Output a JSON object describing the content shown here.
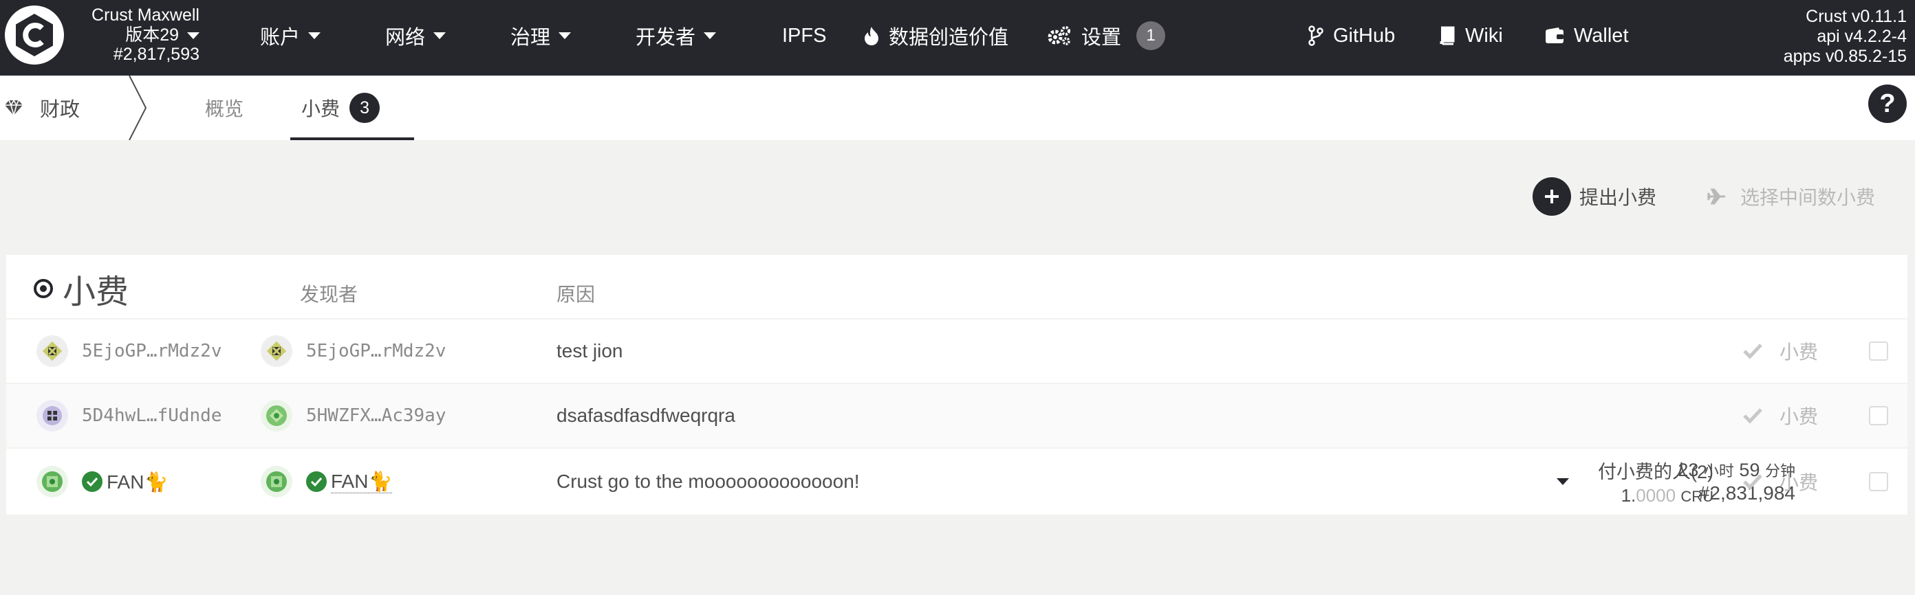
{
  "topbar": {
    "chain_name": "Crust Maxwell",
    "version_label": "版本29",
    "block_number": "#2,817,593",
    "nav": {
      "accounts": "账户",
      "network": "网络",
      "governance": "治理",
      "developer": "开发者",
      "ipfs": "IPFS",
      "data_value": "数据创造价值",
      "settings": "设置",
      "settings_badge": "1",
      "github": "GitHub",
      "wiki": "Wiki",
      "wallet": "Wallet"
    },
    "versions": {
      "crust": "Crust v0.11.1",
      "api": "api v4.2.2-4",
      "apps": "apps v0.85.2-15"
    }
  },
  "subnav": {
    "section": "财政",
    "tabs": [
      {
        "label": "概览"
      },
      {
        "label": "小费",
        "badge": "3"
      }
    ],
    "help": "?"
  },
  "actions": {
    "propose_tip": "提出小费",
    "select_median": "选择中间数小费"
  },
  "table": {
    "title": "小费",
    "col_finder": "发现者",
    "col_reason": "原因",
    "rows": [
      {
        "who": "5EjoGP…rMdz2v",
        "finder": "5EjoGP…rMdz2v",
        "reason": "test jion",
        "action": "小费"
      },
      {
        "who": "5D4hwL…fUdnde",
        "finder": "5HWZFX…Ac39ay",
        "reason": "dsafasdfasdfweqrqra",
        "action": "小费"
      },
      {
        "who": "FAN🐈",
        "finder": "FAN🐈",
        "reason": "Crust go to the mooooooooooooon!",
        "tippers": "付小费的人(2)",
        "amount_int": "1.",
        "amount_dec": "0000",
        "amount_unit": "CRU",
        "time_hours": "23",
        "time_hours_unit": "小时",
        "time_minutes": "59",
        "time_minutes_unit": "分钟",
        "closes_block": "#2,831,984",
        "action": "小费"
      }
    ]
  },
  "colors": {
    "topbar_bg": "#26272c",
    "page_bg": "#f2f2f1",
    "verified_green": "#2e8b3a"
  }
}
